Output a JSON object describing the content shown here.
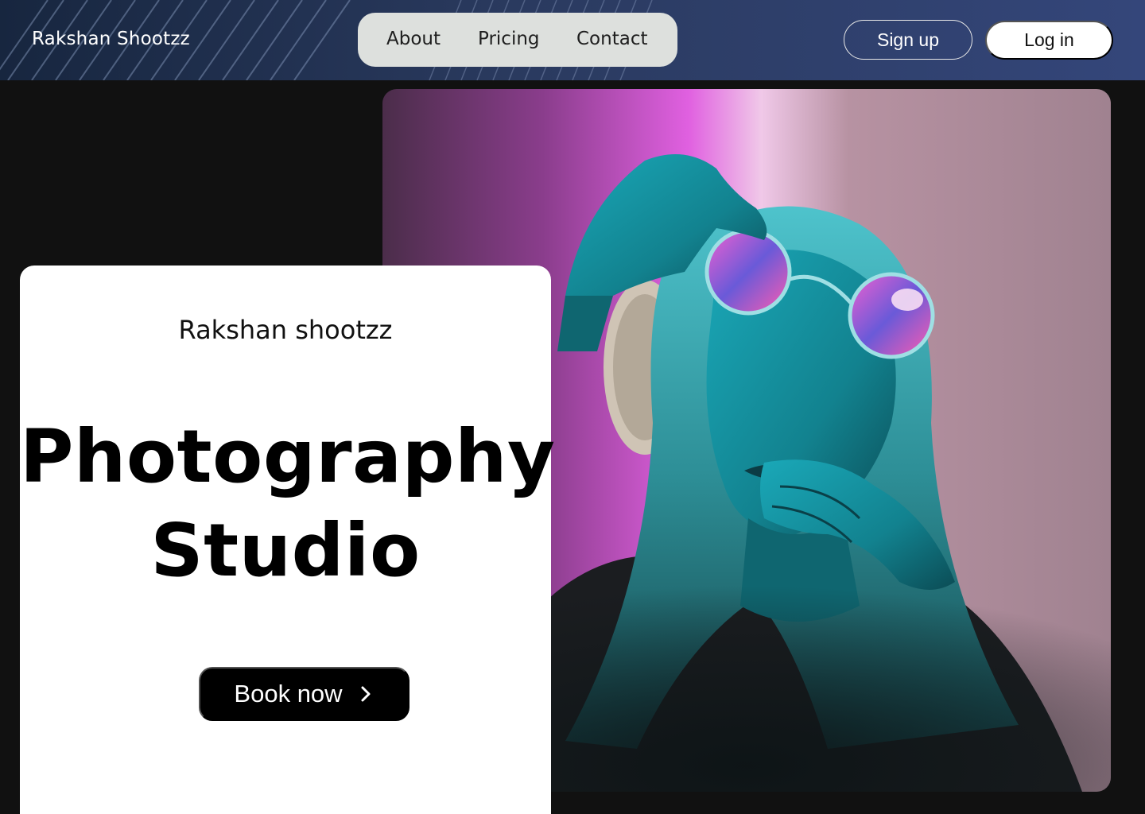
{
  "header": {
    "brand": "Rakshan Shootzz",
    "nav": [
      {
        "label": "About"
      },
      {
        "label": "Pricing"
      },
      {
        "label": "Contact"
      }
    ],
    "signup_label": "Sign up",
    "login_label": "Log in"
  },
  "hero": {
    "subtitle": "Rakshan shootzz",
    "title_line1": "Photography",
    "title_line2": "Studio",
    "cta_label": "Book now",
    "cta_icon": "chevron-right-icon",
    "photo_subject": "portrait-photo"
  },
  "colors": {
    "background": "#111111",
    "header_gradient_start": "#17263f",
    "header_gradient_end": "#34467a",
    "nav_pill": "#dde0dd",
    "card": "#ffffff",
    "cta": "#000000",
    "neon_pink": "#e060e0",
    "neon_cyan": "#19b8c8"
  }
}
